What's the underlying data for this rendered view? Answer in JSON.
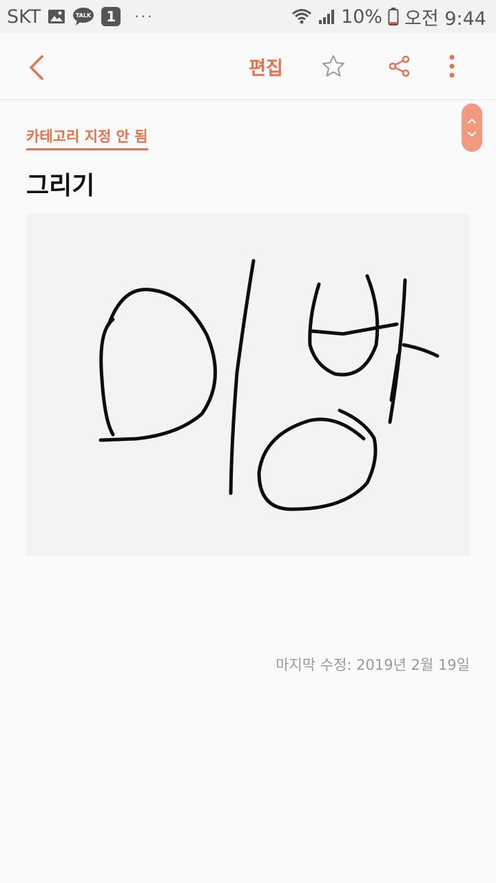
{
  "status_bar": {
    "carrier": "SKT",
    "talk_label": "TALK",
    "badge": "1",
    "more": "···",
    "battery": "10%",
    "time": "오전 9:44",
    "icons": [
      "image-icon",
      "kakaotalk-icon",
      "wifi-icon",
      "signal-icon",
      "battery-icon"
    ]
  },
  "toolbar": {
    "edit_label": "편집",
    "icons": [
      "back-arrow-icon",
      "star-icon",
      "share-icon",
      "more-vertical-icon"
    ]
  },
  "note": {
    "category": "카테고리 지정 안 됨",
    "title": "그리기",
    "drawing_text": "미방",
    "last_modified": "마지막 수정: 2019년 2월 19일"
  },
  "colors": {
    "accent": "#e8704a",
    "scroll_pill": "#f29a7d",
    "background": "#fafafa",
    "drawing_bg": "#f3f3f3"
  }
}
